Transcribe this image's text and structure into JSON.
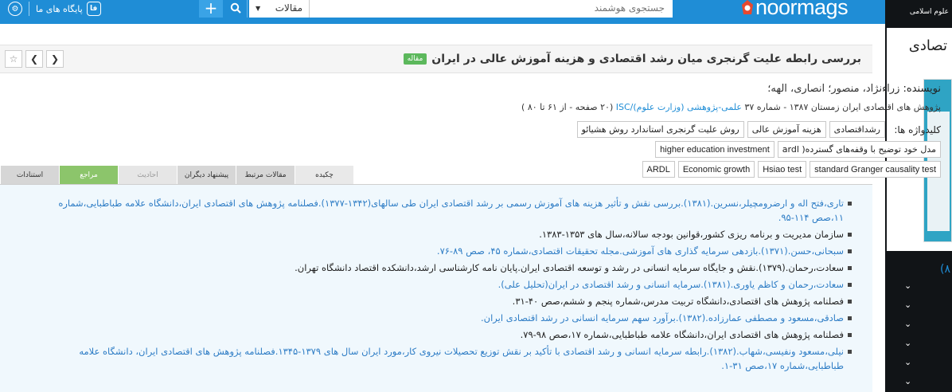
{
  "topbar": {
    "my_bases_label": "پایگاه های ما",
    "my_bases_icon_text": "فا",
    "plus_label": "+",
    "search_type": "مقالات",
    "search_placeholder": "جستجوی هوشمند",
    "logo_text": "noormags",
    "brand_color": "#1f8dd6"
  },
  "right_panel": {
    "top_text": "علوم اسلامی",
    "title_fragment": "تصادی",
    "number_fragment": "(۸"
  },
  "article": {
    "title": "بررسی رابطه علیت گرنجری میان رشد اقتصادی و هزینه آموزش عالی در ایران",
    "badge": "مقاله",
    "authors_label": "نویسنده:",
    "authors": "زراءنژاد، منصور؛ انصاری، الهه؛",
    "source_text": "پژوهش های اقتصادی ایران زمستان ۱۳۸۷ - شماره ۳۷",
    "source_link": "علمی-پژوهشی (وزارت علوم)/ISC",
    "source_pages": "(۲۰ صفحه - از ۶۱ تا ۸۰ )",
    "keywords_label": "کلیدواژه ها:",
    "keywords_row1": [
      "رشداقتصادی",
      "هزینه آموزش عالی",
      "روش علیت گرنجری استاندارد روش هشیائو"
    ],
    "keywords_row2": [
      "مدل خود توضیح با وقفه‌های گسترده( ardl",
      "higher education investment"
    ],
    "keywords_row3": [
      "standard Granger causality test",
      "Hsiao test",
      "Economic growth",
      "ARDL"
    ]
  },
  "tabs": [
    "چکیده",
    "مقالات مرتبط",
    "پیشنهاد دیگران",
    "احادیث",
    "مراجع",
    "استنادات"
  ],
  "references": [
    {
      "text": "تاری،فتح اله و ارضرومچیلر،نسرین.(۱۳۸۱).بررسی نقش و تأثیر هزینه های آموزش رسمی بر رشد اقتصادی ایران طی سالهای(۱۳۴۲-۱۳۷۷).فصلنامه پژوهش های اقتصادی ایران،دانشگاه علامه طباطبایی،شماره ۱۱،صص ۱۱۴-۹۵.",
      "link": true
    },
    {
      "text": "سازمان مدیریت و برنامه ریزی کشور،قوانین بودجه سالانه،سال های ۱۳۵۳-۱۳۸۳.",
      "link": false
    },
    {
      "text": "سبحانی،حسن.(۱۳۷۱).بازدهی سرمایه گذاری های آموزشی.مجله تحقیقات اقتصادی،شماره ۴۵، صص ۸۹-۷۶.",
      "link": true
    },
    {
      "text": "سعادت،رحمان.(۱۳۷۹).نقش و جایگاه سرمایه انسانی در رشد و توسعه اقتصادی ایران.پایان نامه کارشناسی ارشد،دانشکده اقتصاد دانشگاه تهران.",
      "link": false
    },
    {
      "text": "سعادت،رحمان و کاظم یاوری.(۱۳۸۱).سرمایه انسانی و رشد اقتصادی در ایران(تحلیل علی).",
      "link": true
    },
    {
      "text": "فصلنامه پژوهش های اقتصادی،دانشگاه تربیت مدرس،شماره پنجم و ششم،صص ۴۰-۳۱.",
      "link": false
    },
    {
      "text": "صادقی،مسعود و مصطفی عمارزاده.(۱۳۸۲).برآورد سهم سرمایه انسانی در رشد اقتصادی ایران.",
      "link": true
    },
    {
      "text": "فصلنامه پژوهش های اقتصادی ایران،دانشگاه علامه طباطبایی،شماره ۱۷،صص ۹۸-۷۹.",
      "link": false
    },
    {
      "text": "نیلی،مسعود ونفیسی،شهاب.(۱۳۸۲).رابطه سرمایه انسانی و رشد اقتصادی با تأکید بر نقش توزیع تحصیلات نیروی کار،مورد ایران سال های ۱۳۷۹-۱۳۴۵.فصلنامه پژوهش های اقتصادی ایران، دانشگاه علامه طباطبایی،شماره ۱۷،صص ۳۱-۱.",
      "link": true
    }
  ]
}
